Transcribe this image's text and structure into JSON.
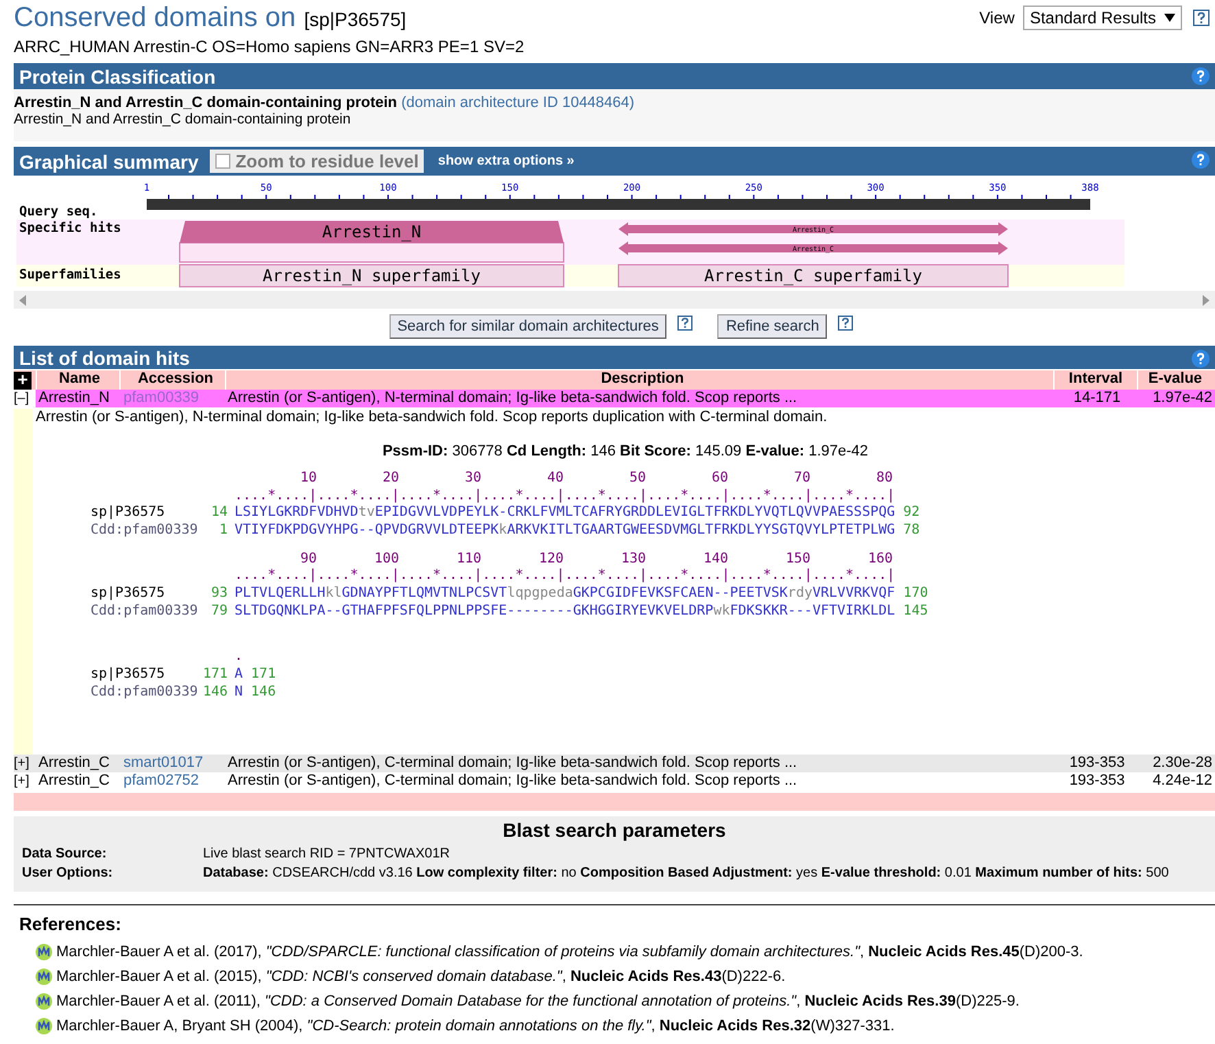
{
  "header": {
    "title": "Conserved domains on",
    "query_id": "[sp|P36575]",
    "subtitle": "ARRC_HUMAN Arrestin-C OS=Homo sapiens GN=ARR3 PE=1 SV=2",
    "view_label": "View",
    "view_value": "Standard Results"
  },
  "classification": {
    "heading": "Protein Classification",
    "name": "Arrestin_N and Arrestin_C domain-containing protein",
    "architecture_link": "(domain architecture ID 10448464)",
    "description": "Arrestin_N and Arrestin_C domain-containing protein"
  },
  "graphical_summary": {
    "heading": "Graphical summary",
    "zoom_checkbox": {
      "label": "Zoom to residue level",
      "checked": false
    },
    "extra_options": "show extra options »",
    "ruler_ticks": [
      "1",
      "50",
      "100",
      "150",
      "200",
      "250",
      "300",
      "350",
      "388"
    ],
    "track_labels": [
      "Query seq.",
      "Specific hits",
      "Superfamilies"
    ],
    "specific_hits": [
      {
        "label": "Arrestin_N",
        "kind": "block"
      },
      {
        "label": "Arrestin_C",
        "kind": "arrow"
      },
      {
        "label": "Arrestin_C",
        "kind": "arrow"
      }
    ],
    "superfamilies": [
      {
        "label": "Arrestin_N superfamily"
      },
      {
        "label": "Arrestin_C superfamily"
      }
    ],
    "buttons": [
      "Search for similar domain architectures",
      "Refine search"
    ]
  },
  "domain_hits": {
    "heading": "List of domain hits",
    "expand_all": "+",
    "columns": [
      "Name",
      "Accession",
      "Description",
      "Interval",
      "E-value"
    ],
    "rows": [
      {
        "toggle": "[–]",
        "expanded": true,
        "name": "Arrestin_N",
        "accession": "pfam00339",
        "description": "Arrestin (or S-antigen), N-terminal domain; Ig-like beta-sandwich fold. Scop reports ...",
        "interval": "14-171",
        "evalue": "1.97e-42"
      },
      {
        "toggle": "[+]",
        "expanded": false,
        "name": "Arrestin_C",
        "accession": "smart01017",
        "description": "Arrestin (or S-antigen), C-terminal domain; Ig-like beta-sandwich fold. Scop reports ...",
        "interval": "193-353",
        "evalue": "2.30e-28"
      },
      {
        "toggle": "[+]",
        "expanded": false,
        "name": "Arrestin_C",
        "accession": "pfam02752",
        "description": "Arrestin (or S-antigen), C-terminal domain; Ig-like beta-sandwich fold. Scop reports ...",
        "interval": "193-353",
        "evalue": "4.24e-12"
      }
    ],
    "detail": {
      "full_description": "Arrestin (or S-antigen), N-terminal domain; Ig-like beta-sandwich fold. Scop reports duplication with C-terminal domain.",
      "stats": "**Pssm-ID:** 306778  **Cd Length:** 146  **Bit Score:** 145.09  **E-value:** 1.97e-42",
      "blocks": [
        {
          "numbers": [
            "10",
            "20",
            "30",
            "40",
            "50",
            "60",
            "70",
            "80"
          ],
          "ruler": "....*....|....*....|....*....|....*....|....*....|....*....|....*....|....*....|",
          "rows": [
            {
              "kind": "query",
              "label": "sp|P36575",
              "start": "14",
              "sequence": "LSIYLGKRDFVDHVDtvEPIDGVVLVDPEYLK-CRKLFVMLTCAFRYGRDDLEVIGLTFRKDLYVQTLQVVPAESSSPQG",
              "end": "92"
            },
            {
              "kind": "subject",
              "label": "Cdd:pfam00339",
              "start": "1",
              "sequence": "VTIYFDKPDGVYHPG--QPVDGRVVLDTEEPKkARKVKITLTGAARTGWEESDVMGLTFRKDLYYSGTQVYLPTETPLWG",
              "end": "78"
            }
          ]
        },
        {
          "numbers": [
            "90",
            "100",
            "110",
            "120",
            "130",
            "140",
            "150",
            "160"
          ],
          "ruler": "....*....|....*....|....*....|....*....|....*....|....*....|....*....|....*....|",
          "rows": [
            {
              "kind": "query",
              "label": "sp|P36575",
              "start": "93",
              "sequence": "PLTVLQERLLHklGDNAYPFTLQMVTNLPCSVTlqpgpedaGKPCGIDFEVKSFCAEN--PEETVSKrdyVRLVVRKVQF",
              "end": "170"
            },
            {
              "kind": "subject",
              "label": "Cdd:pfam00339",
              "start": "79",
              "sequence": "SLTDGQNKLPA--GTHAFPFSFQLPPNLPPSFE--------GKHGGIRYEVKVELDRPwkFDKSKKR---VFTVIRKLDL",
              "end": "145"
            }
          ]
        },
        {
          "ruler": ".",
          "rows": [
            {
              "kind": "query",
              "label": "sp|P36575",
              "start": "171",
              "sequence": "A",
              "end": "171"
            },
            {
              "kind": "subject",
              "label": "Cdd:pfam00339",
              "start": "146",
              "sequence": "N",
              "end": "146"
            }
          ]
        }
      ]
    }
  },
  "blast_parameters": {
    "heading": "Blast search parameters",
    "rows": [
      {
        "label": "Data Source:",
        "value": "Live blast search RID = 7PNTCWAX01R"
      },
      {
        "label": "User Options:",
        "value": "**Database:** CDSEARCH/cdd v3.16  **Low complexity filter:** no  **Composition Based Adjustment:** yes  **E-value threshold:** 0.01  **Maximum number of hits:** 500"
      }
    ]
  },
  "references": {
    "heading": "References:",
    "items": [
      "Marchler-Bauer A et al. (2017), *\"CDD/SPARCLE: functional classification of proteins via subfamily domain architectures.\"*, **Nucleic Acids Res.45**(D)200-3.",
      "Marchler-Bauer A et al. (2015), *\"CDD: NCBI's conserved domain database.\"*, **Nucleic Acids Res.43**(D)222-6.",
      "Marchler-Bauer A et al. (2011), *\"CDD: a Conserved Domain Database for the functional annotation of proteins.\"*, **Nucleic Acids Res.39**(D)225-9.",
      "Marchler-Bauer A, Bryant SH (2004), *\"CD-Search: protein domain annotations on the fly.\"*, **Nucleic Acids Res.32**(W)327-331."
    ]
  }
}
